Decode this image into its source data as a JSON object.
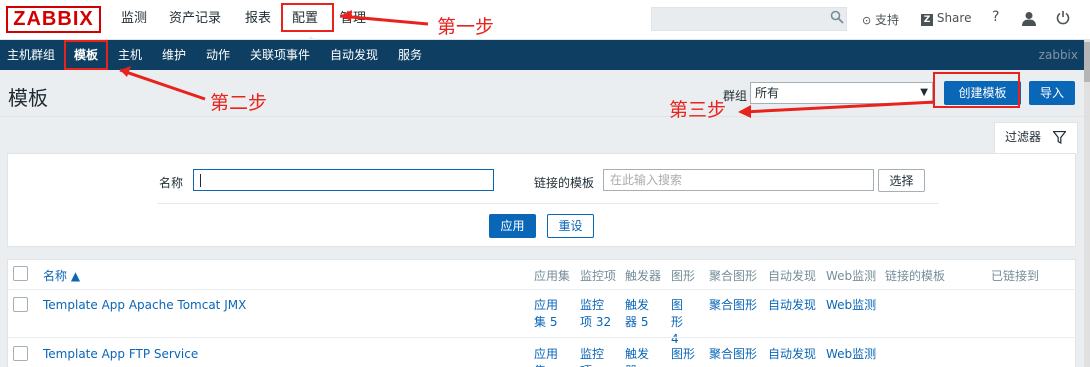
{
  "topbar": {
    "logo": "ZABBIX",
    "menu": [
      "监测",
      "资产记录",
      "报表",
      "配置",
      "管理"
    ],
    "search": {
      "placeholder": ""
    },
    "support": "支持",
    "share": "Share",
    "help": "?"
  },
  "navbar": {
    "items": [
      "主机群组",
      "模板",
      "主机",
      "维护",
      "动作",
      "关联项事件",
      "自动发现",
      "服务"
    ],
    "active": "模板",
    "server": "zabbix"
  },
  "page": {
    "title": "模板",
    "group_label": "群组",
    "group_value": "所有",
    "create_button": "创建模板",
    "import_button": "导入"
  },
  "filter": {
    "tab_label": "过滤器",
    "name_label": "名称",
    "name_value": "",
    "linked_label": "链接的模板",
    "linked_placeholder": "在此输入搜索",
    "select_button": "选择",
    "apply_button": "应用",
    "reset_button": "重设"
  },
  "table": {
    "headers": [
      "名称 ▲",
      "应用集",
      "监控项",
      "触发器",
      "图形",
      "聚合图形",
      "自动发现",
      "Web监测",
      "链接的模板",
      "已链接到"
    ],
    "rows": [
      {
        "name": "Template App Apache Tomcat JMX",
        "apps": "应用集 5",
        "items": "监控项 32",
        "triggers": "触发器 5",
        "graphs": "图形 4",
        "screens": "聚合图形",
        "discovery": "自动发现",
        "web": "Web监测"
      },
      {
        "name": "Template App FTP Service",
        "apps": "应用集",
        "items": "监控项",
        "triggers": "触发器",
        "graphs": "图形",
        "screens": "聚合图形",
        "discovery": "自动发现",
        "web": "Web监测"
      }
    ]
  },
  "annotations": {
    "step1": "第一步",
    "step2": "第二步",
    "step3": "第三步"
  },
  "colors": {
    "nav_bg": "#0e3f63",
    "button_blue": "#0a66b7",
    "annotation_red": "#e8231d",
    "logo_red": "#d40000"
  }
}
